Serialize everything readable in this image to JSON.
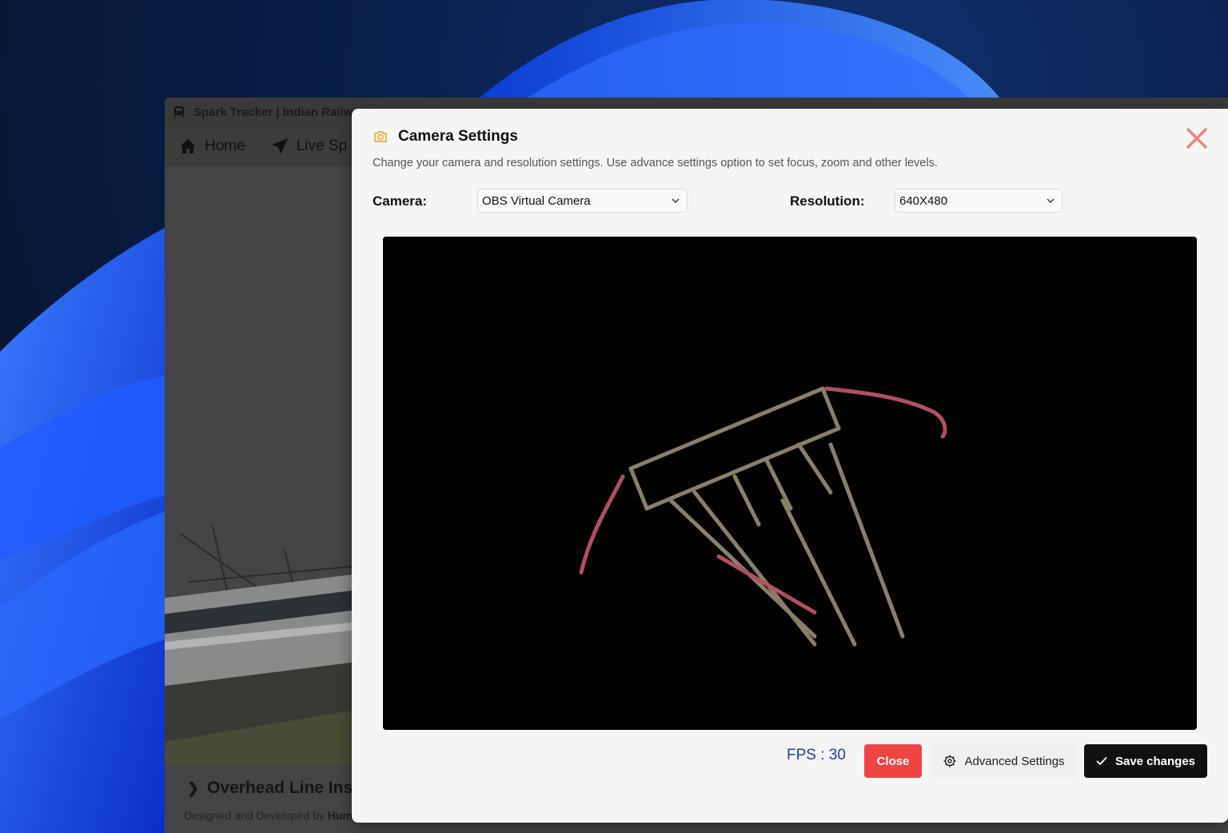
{
  "app": {
    "window_title": "Spark Tracker | Indian Railw",
    "nav": [
      {
        "label": "Home",
        "icon": "home-icon"
      },
      {
        "label": "Live Sp",
        "icon": "send-icon"
      }
    ],
    "footer_heading": "Overhead Line Ins",
    "footer_credit_prefix": "Designed and Developed by",
    "footer_credit_name": "Hum"
  },
  "modal": {
    "title": "Camera Settings",
    "title_icon": "camera-icon",
    "description": "Change your camera and resolution settings. Use advance settings option to set focus, zoom and other levels.",
    "camera_label": "Camera:",
    "camera_value": "OBS Virtual Camera",
    "resolution_label": "Resolution:",
    "resolution_value": "640X480",
    "fps_text": "FPS : 30",
    "buttons": {
      "close": "Close",
      "advanced": "Advanced Settings",
      "save": "Save changes"
    },
    "colors": {
      "close_x": "#f08080",
      "close_button": "#ef4444",
      "fps": "#1e40af",
      "camera_icon": "#f59e0b",
      "save_button": "#111111"
    }
  }
}
